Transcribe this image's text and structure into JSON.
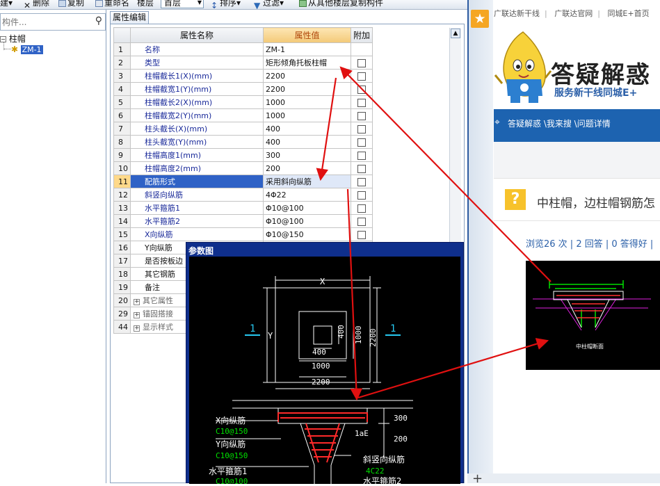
{
  "toolbar": {
    "items": [
      "建▾",
      "删除",
      "复制",
      "重命名",
      "楼层",
      "排序▾",
      "过滤▾",
      "从其他楼层复制构件"
    ],
    "floor_value": "首层"
  },
  "left": {
    "search_placeholder": "构件...",
    "tree_root": "柱帽",
    "tree_child": "ZM-1"
  },
  "editor": {
    "tab": "属性编辑",
    "headers": {
      "name": "属性名称",
      "value": "属性值",
      "extra": "附加"
    },
    "rows": [
      {
        "num": "1",
        "name": "名称",
        "value": "ZM-1",
        "check": false
      },
      {
        "num": "2",
        "name": "类型",
        "value": "矩形倾角托板柱帽",
        "check": true
      },
      {
        "num": "3",
        "name": "柱帽截长1(X)(mm)",
        "value": "2200",
        "check": true
      },
      {
        "num": "4",
        "name": "柱帽截宽1(Y)(mm)",
        "value": "2200",
        "check": true
      },
      {
        "num": "5",
        "name": "柱帽截长2(X)(mm)",
        "value": "1000",
        "check": true
      },
      {
        "num": "6",
        "name": "柱帽截宽2(Y)(mm)",
        "value": "1000",
        "check": true
      },
      {
        "num": "7",
        "name": "柱头截长(X)(mm)",
        "value": "400",
        "check": true
      },
      {
        "num": "8",
        "name": "柱头截宽(Y)(mm)",
        "value": "400",
        "check": true
      },
      {
        "num": "9",
        "name": "柱帽高度1(mm)",
        "value": "300",
        "check": true
      },
      {
        "num": "10",
        "name": "柱帽高度2(mm)",
        "value": "200",
        "check": true
      },
      {
        "num": "11",
        "name": "配筋形式",
        "value": "采用斜向纵筋",
        "check": true
      },
      {
        "num": "12",
        "name": "斜竖向纵筋",
        "value": "4Φ22",
        "check": true
      },
      {
        "num": "13",
        "name": "水平箍筋1",
        "value": "Φ10@100",
        "check": true
      },
      {
        "num": "14",
        "name": "水平箍筋2",
        "value": "Φ10@100",
        "check": true
      },
      {
        "num": "15",
        "name": "X向纵筋",
        "value": "Φ10@150",
        "check": true
      },
      {
        "num": "16",
        "name": "Y向纵筋",
        "value": "",
        "check": false
      },
      {
        "num": "17",
        "name": "是否按板边",
        "value": "",
        "check": false
      },
      {
        "num": "18",
        "name": "其它钢筋",
        "value": "",
        "check": false
      },
      {
        "num": "19",
        "name": "备注",
        "value": "",
        "check": false
      },
      {
        "num": "20",
        "name": "其它属性",
        "value": "",
        "check": false
      },
      {
        "num": "29",
        "name": "锚固搭接",
        "value": "",
        "check": false
      },
      {
        "num": "44",
        "name": "显示样式",
        "value": "",
        "check": false
      }
    ],
    "selected_row": "11"
  },
  "param_window": {
    "title": "参数图",
    "labels": {
      "x": "X",
      "y": "Y",
      "one": "1",
      "d400a": "400",
      "d400b": "400",
      "d1000a": "1000",
      "d1000b": "1000",
      "d2200a": "2200",
      "d2200b": "2200",
      "h300": "300",
      "h200": "200",
      "lae": "1aE",
      "xbar": "X向纵筋",
      "xbar_val": "C10@150",
      "ybar": "Y向纵筋",
      "ybar_val": "C10@150",
      "hoop1": "水平箍筋1",
      "hoop1_val": "C10@100",
      "slant": "斜竖向纵筋",
      "slant_val": "4C22",
      "hoop2": "水平箍筋2"
    }
  },
  "browser": {
    "nav": [
      "广联达新干线",
      "广联达官网",
      "同城E+首页"
    ],
    "logo_title": "答疑解惑",
    "logo_sub": "服务新干线同城E+",
    "breadcrumb": "答疑解惑 \\我来搜 \\问题详情",
    "question": "中柱帽，边柱帽钢筋怎",
    "stats": "浏览26 次 | 2 回答 | 0 答得好 |",
    "thumb_caption": "中柱帽断面"
  },
  "colors": {
    "accent_blue": "#1d63b0",
    "selected_row": "#2f62c6",
    "arrow_red": "#e01010",
    "cad_green": "#00e000"
  }
}
